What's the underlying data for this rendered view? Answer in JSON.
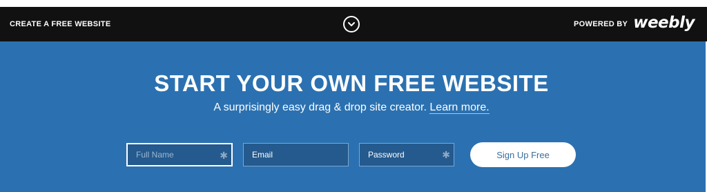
{
  "topbar": {
    "create_link": "CREATE A FREE WEBSITE",
    "toggle_icon": "chevron-down-icon",
    "powered_by": "POWERED BY",
    "brand": "weebly"
  },
  "hero": {
    "title": "START YOUR OWN FREE WEBSITE",
    "subtitle": "A surprisingly easy drag & drop site creator.",
    "learn_more": "Learn more."
  },
  "form": {
    "full_name_placeholder": "Full Name",
    "email_placeholder": "Email",
    "password_placeholder": "Password",
    "required_marker": "✱",
    "submit_label": "Sign Up Free"
  },
  "colors": {
    "topbar_bg": "#111111",
    "hero_bg": "#2b71b1",
    "field_bg": "#245a8e",
    "button_text": "#3a6d9c"
  }
}
